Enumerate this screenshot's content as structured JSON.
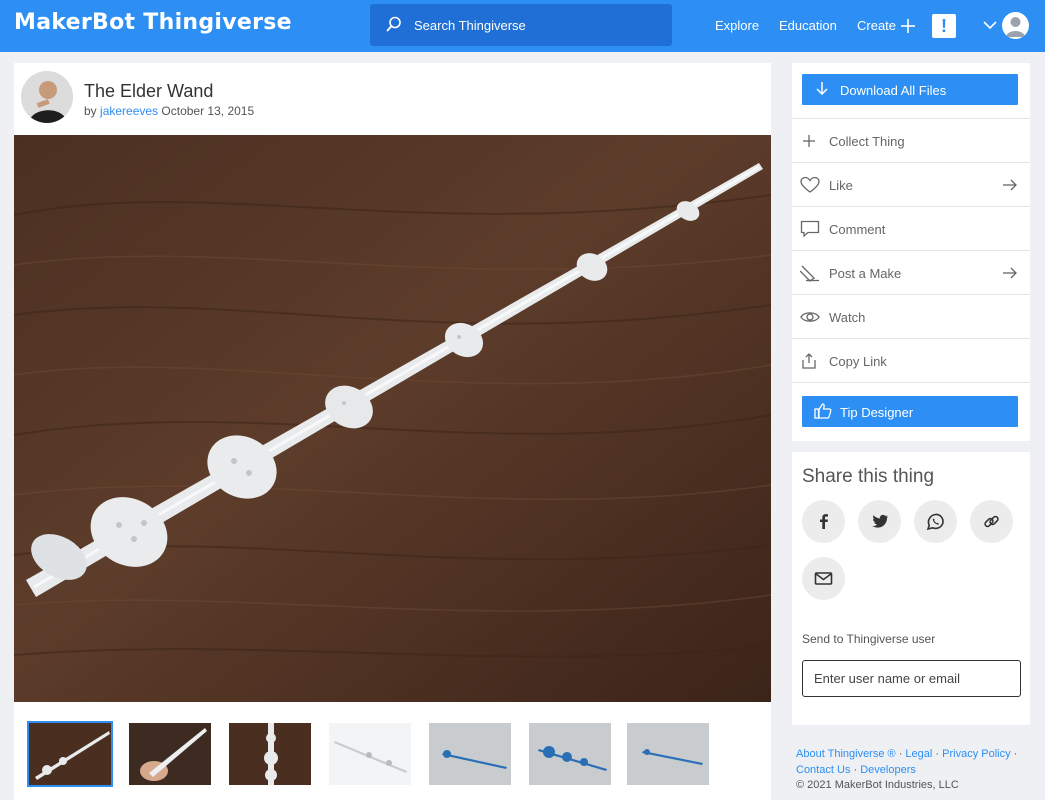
{
  "brand": {
    "logo_text": "MakerBot Thingiverse",
    "accent": "#2d8ff3"
  },
  "header": {
    "search_placeholder": "Search Thingiverse",
    "nav": {
      "explore": "Explore",
      "education": "Education",
      "create": "Create"
    },
    "alert_glyph": "!",
    "icons": [
      "search-icon",
      "plus-icon",
      "alert-icon",
      "chevron-down-icon",
      "user-avatar-icon"
    ]
  },
  "thing": {
    "title": "The Elder Wand",
    "by_prefix": "by",
    "author": "jakereeves",
    "date": "October 13, 2015"
  },
  "gallery": {
    "thumbnail_count": 7,
    "selected_index": 0
  },
  "actions": {
    "download_all": "Download All Files",
    "collect": "Collect Thing",
    "like": "Like",
    "comment": "Comment",
    "post_make": "Post a Make",
    "watch": "Watch",
    "copy_link": "Copy Link",
    "tip": "Tip Designer"
  },
  "share": {
    "title": "Share this thing",
    "targets": [
      "facebook-icon",
      "twitter-icon",
      "whatsapp-icon",
      "link-icon",
      "email-icon"
    ],
    "send_label": "Send to Thingiverse user",
    "input_placeholder": "Enter user name or email"
  },
  "footer": {
    "about": "About Thingiverse ®",
    "legal": "Legal",
    "privacy": "Privacy Policy",
    "contact": "Contact Us",
    "developers": "Developers",
    "sep": "·",
    "copyright": "© 2021 MakerBot Industries, LLC"
  }
}
